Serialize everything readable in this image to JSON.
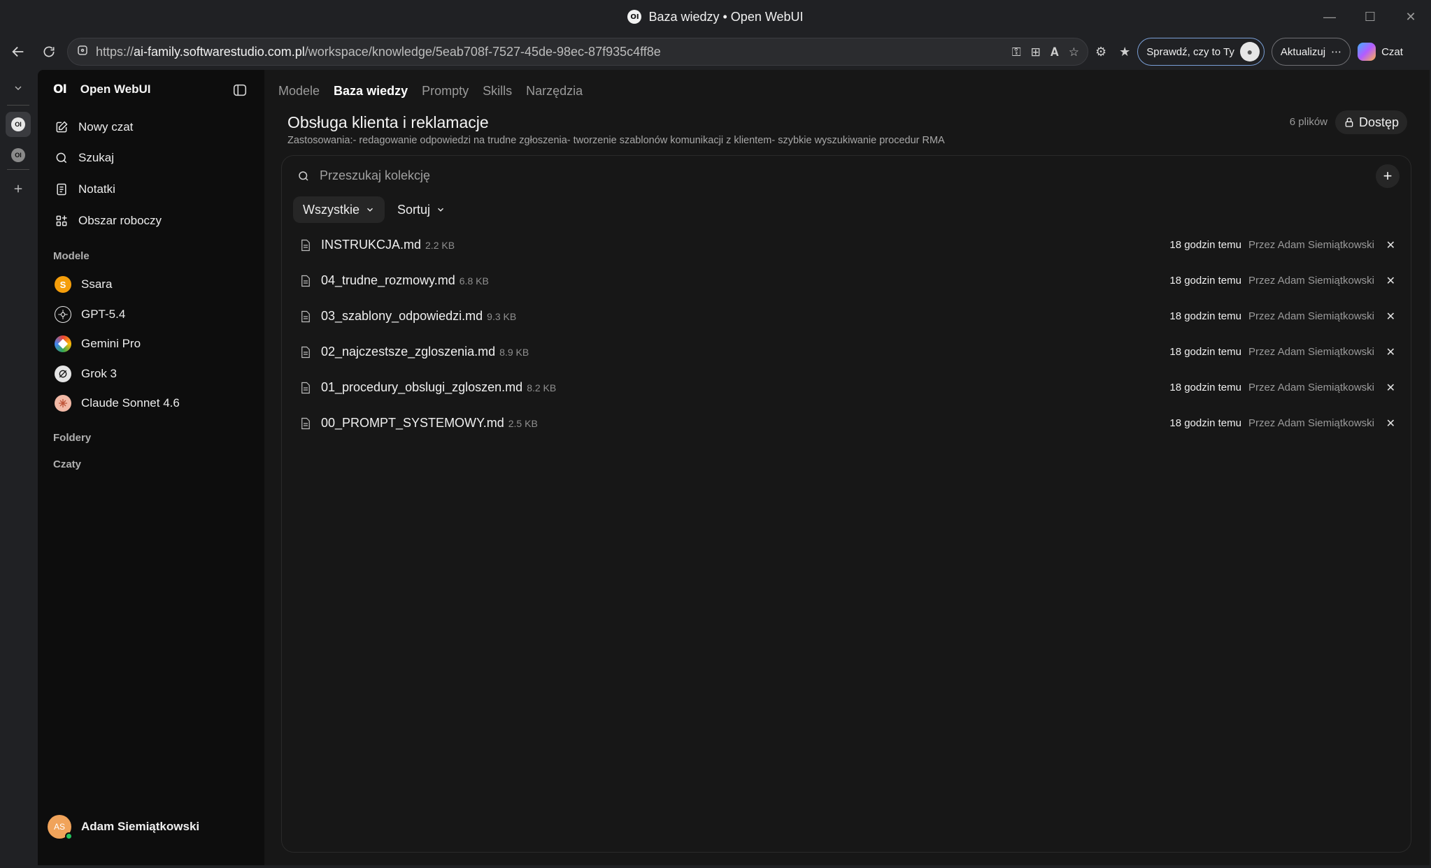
{
  "window": {
    "title": "Baza wiedzy • Open WebUI",
    "logo_text": "OI"
  },
  "browser": {
    "url_prefix": "https://",
    "url_host": "ai-family.softwarestudio.com.pl",
    "url_path": "/workspace/knowledge/5eab708f-7527-45de-98ec-87f935c4ff8e",
    "profile_button": "Sprawdź, czy to Ty",
    "update_button": "Aktualizuj",
    "copilot_label": "Czat"
  },
  "sidebar": {
    "brand_logo": "OI",
    "brand_name": "Open WebUI",
    "nav": [
      {
        "label": "Nowy czat"
      },
      {
        "label": "Szukaj"
      },
      {
        "label": "Notatki"
      },
      {
        "label": "Obszar roboczy"
      }
    ],
    "models_heading": "Modele",
    "models": [
      {
        "label": "Ssara",
        "color": "#f59e0b",
        "icon": "S"
      },
      {
        "label": "GPT-5.4",
        "color": "#0d0d0d",
        "icon": "openai-icon"
      },
      {
        "label": "Gemini Pro",
        "color": "#4f8df6",
        "icon": "gemini-icon"
      },
      {
        "label": "Grok 3",
        "color": "#e5e5e5",
        "icon": "grok-icon"
      },
      {
        "label": "Claude Sonnet 4.6",
        "color": "#e8866a",
        "icon": "claude-icon"
      }
    ],
    "folders_heading": "Foldery",
    "chats_heading": "Czaty",
    "user": {
      "initials": "AS",
      "name": "Adam Siemiątkowski"
    }
  },
  "main": {
    "tabs": [
      {
        "label": "Modele",
        "active": false
      },
      {
        "label": "Baza wiedzy",
        "active": true
      },
      {
        "label": "Prompty",
        "active": false
      },
      {
        "label": "Skills",
        "active": false
      },
      {
        "label": "Narzędzia",
        "active": false
      }
    ],
    "title": "Obsługa klienta i reklamacje",
    "description": "Zastosowania:- redagowanie odpowiedzi na trudne zgłoszenia- tworzenie szablonów komunikacji z klientem- szybkie wyszukiwanie procedur RMA",
    "file_count": "6 plików",
    "access_label": "Dostęp",
    "search_placeholder": "Przeszukaj kolekcję",
    "filter_all": "Wszystkie",
    "sort_label": "Sortuj",
    "files": [
      {
        "name": "INSTRUKCJA.md",
        "size": "2.2 KB",
        "time": "18 godzin temu",
        "author": "Przez Adam Siemiątkowski"
      },
      {
        "name": "04_trudne_rozmowy.md",
        "size": "6.8 KB",
        "time": "18 godzin temu",
        "author": "Przez Adam Siemiątkowski"
      },
      {
        "name": "03_szablony_odpowiedzi.md",
        "size": "9.3 KB",
        "time": "18 godzin temu",
        "author": "Przez Adam Siemiątkowski"
      },
      {
        "name": "02_najczestsze_zgloszenia.md",
        "size": "8.9 KB",
        "time": "18 godzin temu",
        "author": "Przez Adam Siemiątkowski"
      },
      {
        "name": "01_procedury_obslugi_zgloszen.md",
        "size": "8.2 KB",
        "time": "18 godzin temu",
        "author": "Przez Adam Siemiątkowski"
      },
      {
        "name": "00_PROMPT_SYSTEMOWY.md",
        "size": "2.5 KB",
        "time": "18 godzin temu",
        "author": "Przez Adam Siemiątkowski"
      }
    ]
  }
}
